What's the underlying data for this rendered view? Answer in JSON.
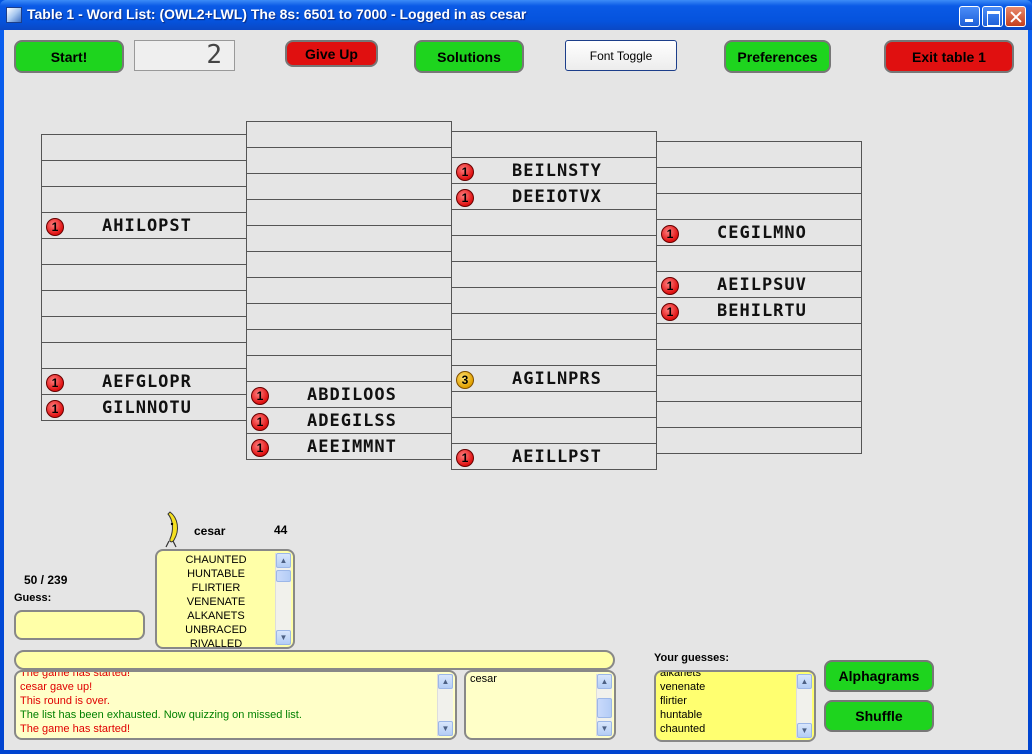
{
  "window": {
    "title": "Table 1 - Word List: (OWL2+LWL) The 8s: 6501 to 7000 - Logged in as cesar"
  },
  "toolbar": {
    "start_label": "Start!",
    "timer_value": "2",
    "give_up_label": "Give Up",
    "solutions_label": "Solutions",
    "font_toggle_label": "Font Toggle",
    "preferences_label": "Preferences",
    "exit_label": "Exit table 1"
  },
  "board": {
    "columns": [
      {
        "cells": [
          {
            "badge": "",
            "word": ""
          },
          {
            "badge": "",
            "word": ""
          },
          {
            "badge": "",
            "word": ""
          },
          {
            "badge": "1",
            "word": "AHILOPST"
          },
          {
            "badge": "",
            "word": ""
          },
          {
            "badge": "",
            "word": ""
          },
          {
            "badge": "",
            "word": ""
          },
          {
            "badge": "",
            "word": ""
          },
          {
            "badge": "",
            "word": ""
          },
          {
            "badge": "1",
            "word": "AEFGLOPR"
          },
          {
            "badge": "1",
            "word": "GILNNOTU"
          }
        ]
      },
      {
        "cells": [
          {
            "badge": "",
            "word": ""
          },
          {
            "badge": "",
            "word": ""
          },
          {
            "badge": "",
            "word": ""
          },
          {
            "badge": "",
            "word": ""
          },
          {
            "badge": "",
            "word": ""
          },
          {
            "badge": "",
            "word": ""
          },
          {
            "badge": "",
            "word": ""
          },
          {
            "badge": "",
            "word": ""
          },
          {
            "badge": "",
            "word": ""
          },
          {
            "badge": "",
            "word": ""
          },
          {
            "badge": "1",
            "word": "ABDILOOS"
          },
          {
            "badge": "1",
            "word": "ADEGILSS"
          },
          {
            "badge": "1",
            "word": "AEEIMMNT"
          }
        ]
      },
      {
        "cells": [
          {
            "badge": "",
            "word": ""
          },
          {
            "badge": "1",
            "word": "BEILNSTY"
          },
          {
            "badge": "1",
            "word": "DEEIOTVX"
          },
          {
            "badge": "",
            "word": ""
          },
          {
            "badge": "",
            "word": ""
          },
          {
            "badge": "",
            "word": ""
          },
          {
            "badge": "",
            "word": ""
          },
          {
            "badge": "",
            "word": ""
          },
          {
            "badge": "",
            "word": ""
          },
          {
            "badge": "3",
            "word": "AGILNPRS"
          },
          {
            "badge": "",
            "word": ""
          },
          {
            "badge": "",
            "word": ""
          },
          {
            "badge": "1",
            "word": "AEILLPST"
          }
        ]
      },
      {
        "cells": [
          {
            "badge": "",
            "word": ""
          },
          {
            "badge": "",
            "word": ""
          },
          {
            "badge": "",
            "word": ""
          },
          {
            "badge": "1",
            "word": "CEGILMNO"
          },
          {
            "badge": "",
            "word": ""
          },
          {
            "badge": "1",
            "word": "AEILPSUV"
          },
          {
            "badge": "1",
            "word": "BEHILRTU"
          },
          {
            "badge": "",
            "word": ""
          },
          {
            "badge": "",
            "word": ""
          },
          {
            "badge": "",
            "word": ""
          },
          {
            "badge": "",
            "word": ""
          },
          {
            "badge": "",
            "word": ""
          }
        ]
      }
    ]
  },
  "player": {
    "name": "cesar",
    "score": "44",
    "progress": "50 / 239",
    "guess_label": "Guess:",
    "answers": [
      "CHAUNTED",
      "HUNTABLE",
      "FLIRTIER",
      "VENENATE",
      "ALKANETS",
      "UNBRACED",
      "RIVALLED"
    ]
  },
  "chat": {
    "log": [
      {
        "text": "The game has started!",
        "color": "#e00000"
      },
      {
        "text": "cesar gave up!",
        "color": "#e00000"
      },
      {
        "text": "This round is over.",
        "color": "#e00000"
      },
      {
        "text": "The list has been exhausted. Now quizzing on missed list.",
        "color": "#008000"
      },
      {
        "text": "The game has started!",
        "color": "#e00000"
      }
    ],
    "users": [
      "cesar"
    ]
  },
  "your_guesses": {
    "label": "Your guesses:",
    "items": [
      "alkanets",
      "venenate",
      "flirtier",
      "huntable",
      "chaunted"
    ]
  },
  "side_buttons": {
    "alphagrams_label": "Alphagrams",
    "shuffle_label": "Shuffle"
  },
  "colors": {
    "accent_green": "#1ed41e",
    "accent_red": "#e01010",
    "badge_red": "#e01010",
    "badge_gold": "#e0a000",
    "panel_yellow": "#ffffa8"
  }
}
